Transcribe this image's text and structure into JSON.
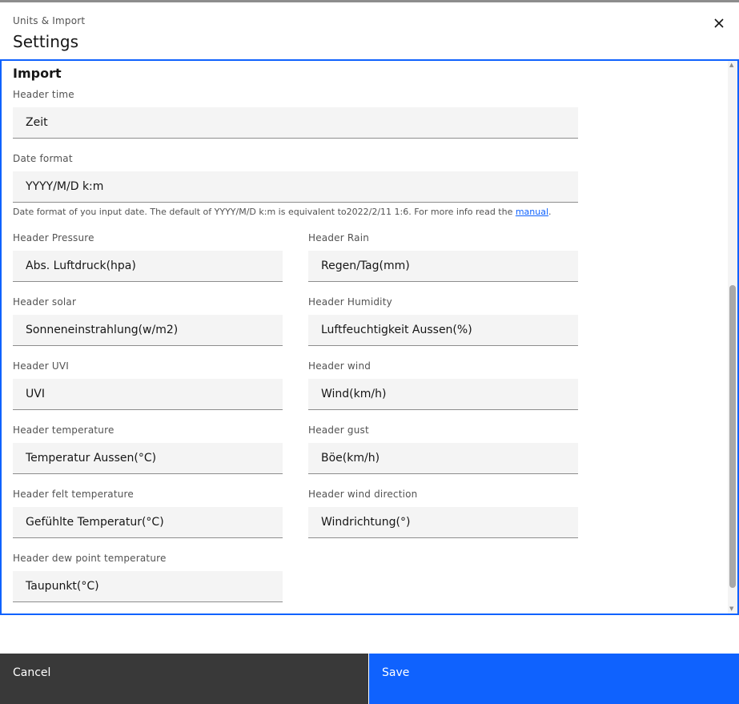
{
  "header": {
    "label": "Units & Import",
    "title": "Settings",
    "close_icon": "close-icon"
  },
  "section": {
    "title": "Import"
  },
  "fields": {
    "header_time": {
      "label": "Header time",
      "value": "Zeit"
    },
    "date_format": {
      "label": "Date format",
      "value": "YYYY/M/D k:m"
    },
    "header_pressure": {
      "label": "Header Pressure",
      "value": "Abs. Luftdruck(hpa)"
    },
    "header_rain": {
      "label": "Header Rain",
      "value": "Regen/Tag(mm)"
    },
    "header_solar": {
      "label": "Header solar",
      "value": "Sonneneinstrahlung(w/m2)"
    },
    "header_humidity": {
      "label": "Header Humidity",
      "value": "Luftfeuchtigkeit Aussen(%)"
    },
    "header_uvi": {
      "label": "Header UVI",
      "value": "UVI"
    },
    "header_wind": {
      "label": "Header wind",
      "value": "Wind(km/h)"
    },
    "header_temperature": {
      "label": "Header temperature",
      "value": "Temperatur Aussen(°C)"
    },
    "header_gust": {
      "label": "Header gust",
      "value": "Böe(km/h)"
    },
    "header_felt_temperature": {
      "label": "Header felt temperature",
      "value": "Gefühlte Temperatur(°C)"
    },
    "header_wind_direction": {
      "label": "Header wind direction",
      "value": "Windrichtung(°)"
    },
    "header_dew_point": {
      "label": "Header dew point temperature",
      "value": "Taupunkt(°C)"
    }
  },
  "helper": {
    "text": "Date format of you input date. The default of YYYY/M/D k:m is equivalent to2022/2/11 1:6. For more info read the ",
    "link": "manual",
    "suffix": "."
  },
  "footer": {
    "cancel_label": "Cancel",
    "save_label": "Save"
  },
  "colors": {
    "primary": "#0f62fe",
    "secondary": "#393939",
    "field_bg": "#f4f4f4"
  }
}
